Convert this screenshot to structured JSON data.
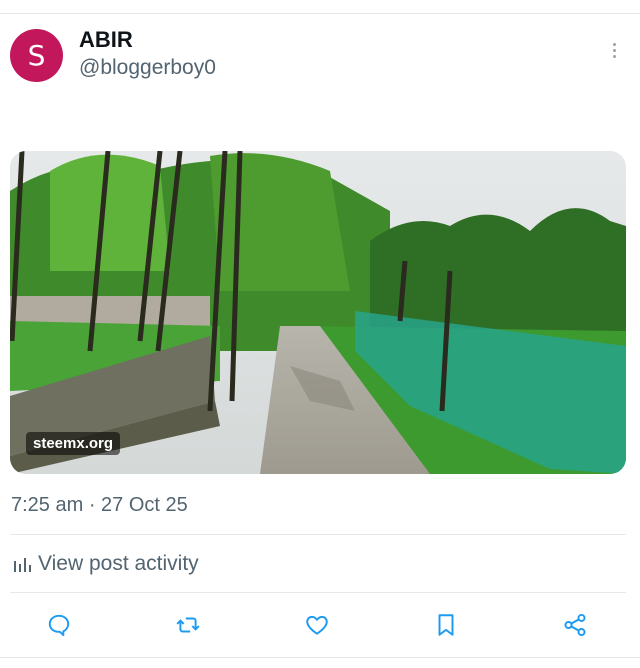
{
  "author": {
    "avatar_letter": "S",
    "avatar_color": "#c2185b",
    "display_name": "ABIR",
    "handle": "@bloggerboy0"
  },
  "media": {
    "watermark": "steemx.org"
  },
  "post": {
    "timestamp": "7:25 am · 27 Oct 25",
    "activity_label": "View post activity"
  },
  "actions": {
    "icons": [
      "reply-icon",
      "repost-icon",
      "like-icon",
      "bookmark-icon",
      "share-icon"
    ]
  },
  "colors": {
    "secondary_text": "#536471",
    "icon_accent": "#1d9bf0"
  }
}
